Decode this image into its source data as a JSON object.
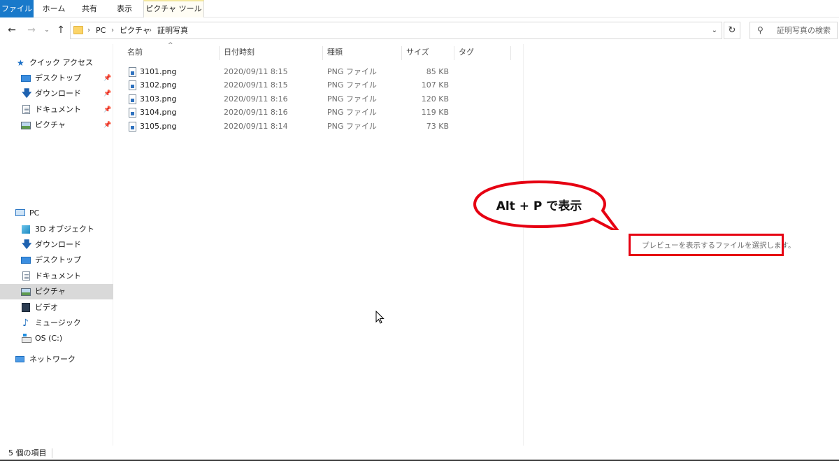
{
  "ribbon": {
    "tabs": [
      "ファイル",
      "ホーム",
      "共有",
      "表示",
      "ピクチャ ツール"
    ]
  },
  "address": {
    "crumbs": [
      "PC",
      "ピクチャ",
      "証明写真"
    ],
    "search_placeholder": "証明写真の検索"
  },
  "navpane": {
    "quick_access": "クイック アクセス",
    "quick_items": [
      "デスクトップ",
      "ダウンロード",
      "ドキュメント",
      "ピクチャ"
    ],
    "pc": "PC",
    "pc_items": [
      "3D オブジェクト",
      "ダウンロード",
      "デスクトップ",
      "ドキュメント",
      "ピクチャ",
      "ビデオ",
      "ミュージック",
      "OS (C:)"
    ],
    "network": "ネットワーク",
    "selected": "ピクチャ"
  },
  "columns": [
    "名前",
    "日付時刻",
    "種類",
    "サイズ",
    "タグ"
  ],
  "files": [
    {
      "name": "3101.png",
      "date": "2020/09/11 8:15",
      "type": "PNG ファイル",
      "size": "85 KB"
    },
    {
      "name": "3102.png",
      "date": "2020/09/11 8:15",
      "type": "PNG ファイル",
      "size": "107 KB"
    },
    {
      "name": "3103.png",
      "date": "2020/09/11 8:16",
      "type": "PNG ファイル",
      "size": "120 KB"
    },
    {
      "name": "3104.png",
      "date": "2020/09/11 8:16",
      "type": "PNG ファイル",
      "size": "119 KB"
    },
    {
      "name": "3105.png",
      "date": "2020/09/11 8:14",
      "type": "PNG ファイル",
      "size": "73 KB"
    }
  ],
  "preview": {
    "message": "プレビューを表示するファイルを選択します。"
  },
  "callout": {
    "text": "Alt + P で表示"
  },
  "status": {
    "count": "5 個の項目"
  },
  "colors": {
    "file_tab": "#1979ca",
    "highlight_red": "#e60012",
    "selected_nav": "#d9d9d9"
  }
}
